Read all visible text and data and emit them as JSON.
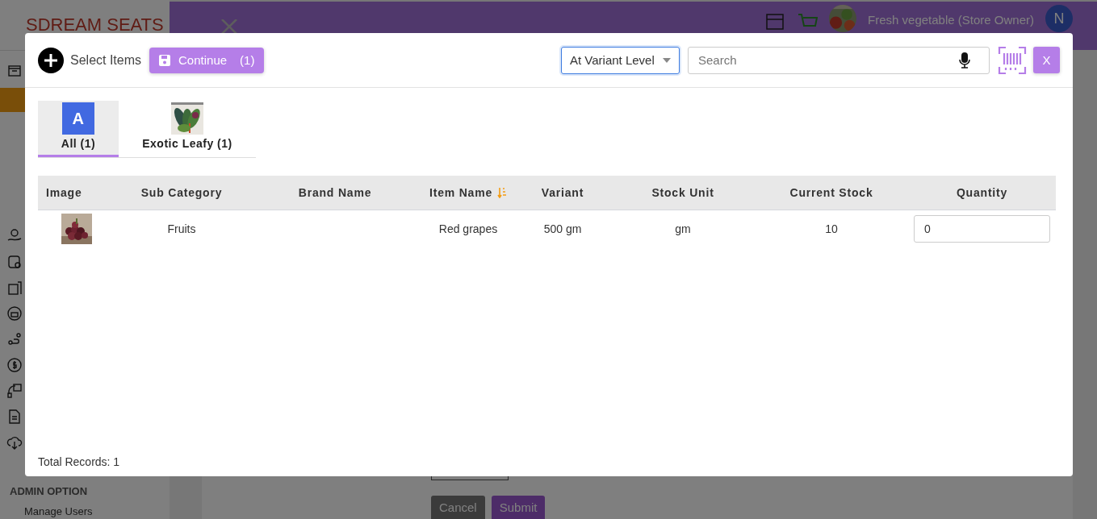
{
  "background": {
    "logo": "SDREAM SEATS",
    "header": {
      "store_name": "Fresh vegetable (Store Owner)",
      "avatar_initial": "N"
    },
    "sidebar": {
      "section_title": "ADMIN OPTION",
      "items": [
        {
          "label": "Manage Users"
        }
      ]
    },
    "form_buttons": [
      {
        "label": "Cancel",
        "kind": "cancel"
      },
      {
        "label": "Submit",
        "kind": "submit"
      }
    ]
  },
  "modal": {
    "title": "Select Items",
    "continue_button": {
      "label": "Continue",
      "count": "(1)"
    },
    "level_select": "At Variant Level",
    "search": {
      "placeholder": "Search"
    },
    "close_button": "X",
    "categories": [
      {
        "label": "All (1)",
        "kind": "letter",
        "letter": "A",
        "selected": true
      },
      {
        "label": "Exotic Leafy (1)",
        "kind": "picture",
        "selected": false
      }
    ],
    "table": {
      "columns": [
        {
          "label": "Image",
          "sorted": false
        },
        {
          "label": "Sub Category",
          "sorted": false
        },
        {
          "label": "Brand Name",
          "sorted": false
        },
        {
          "label": "Item Name",
          "sorted": true
        },
        {
          "label": "Variant",
          "sorted": false
        },
        {
          "label": "Stock Unit",
          "sorted": false
        },
        {
          "label": "Current Stock",
          "sorted": false
        },
        {
          "label": "Quantity",
          "sorted": false
        }
      ],
      "rows": [
        {
          "sub_category": "Fruits",
          "item_name": "Red grapes",
          "variant": "500 gm",
          "stock_unit": "gm",
          "current_stock": "10",
          "quantity": "0"
        }
      ]
    },
    "total_records": "Total Records: 1"
  }
}
